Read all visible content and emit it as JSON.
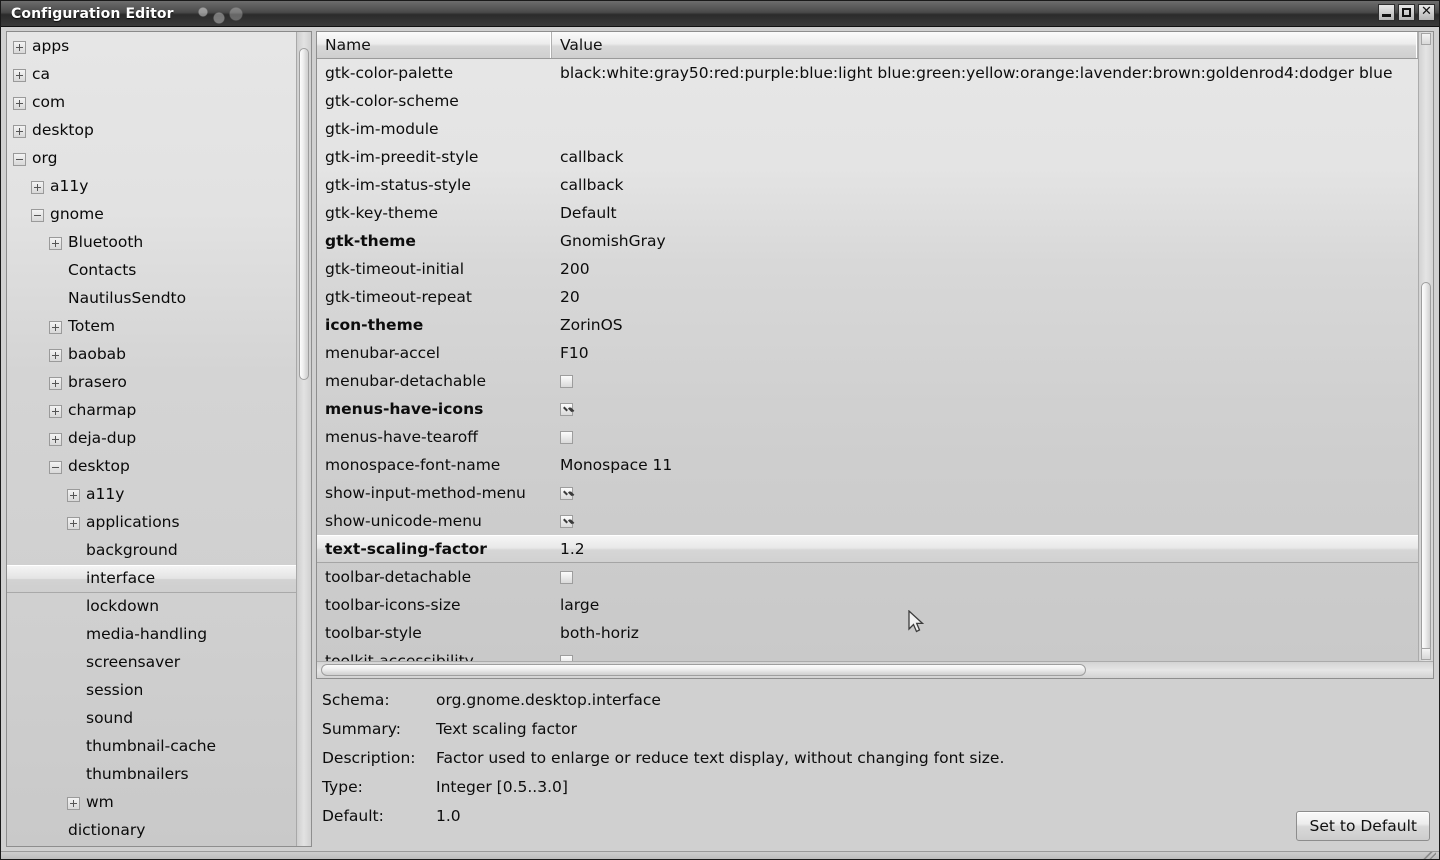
{
  "window": {
    "title": "Configuration Editor",
    "controls": {
      "minimize": "minimize-icon",
      "maximize": "maximize-icon",
      "close": "✕"
    }
  },
  "tree": {
    "items": [
      {
        "label": "apps",
        "depth": 0,
        "expander": "plus"
      },
      {
        "label": "ca",
        "depth": 0,
        "expander": "plus"
      },
      {
        "label": "com",
        "depth": 0,
        "expander": "plus"
      },
      {
        "label": "desktop",
        "depth": 0,
        "expander": "plus"
      },
      {
        "label": "org",
        "depth": 0,
        "expander": "minus"
      },
      {
        "label": "a11y",
        "depth": 1,
        "expander": "plus"
      },
      {
        "label": "gnome",
        "depth": 1,
        "expander": "minus"
      },
      {
        "label": "Bluetooth",
        "depth": 2,
        "expander": "plus"
      },
      {
        "label": "Contacts",
        "depth": 2,
        "expander": "none"
      },
      {
        "label": "NautilusSendto",
        "depth": 2,
        "expander": "none"
      },
      {
        "label": "Totem",
        "depth": 2,
        "expander": "plus"
      },
      {
        "label": "baobab",
        "depth": 2,
        "expander": "plus"
      },
      {
        "label": "brasero",
        "depth": 2,
        "expander": "plus"
      },
      {
        "label": "charmap",
        "depth": 2,
        "expander": "plus"
      },
      {
        "label": "deja-dup",
        "depth": 2,
        "expander": "plus"
      },
      {
        "label": "desktop",
        "depth": 2,
        "expander": "minus"
      },
      {
        "label": "a11y",
        "depth": 3,
        "expander": "plus"
      },
      {
        "label": "applications",
        "depth": 3,
        "expander": "plus"
      },
      {
        "label": "background",
        "depth": 3,
        "expander": "none"
      },
      {
        "label": "interface",
        "depth": 3,
        "expander": "none",
        "selected": true
      },
      {
        "label": "lockdown",
        "depth": 3,
        "expander": "none"
      },
      {
        "label": "media-handling",
        "depth": 3,
        "expander": "none"
      },
      {
        "label": "screensaver",
        "depth": 3,
        "expander": "none"
      },
      {
        "label": "session",
        "depth": 3,
        "expander": "none"
      },
      {
        "label": "sound",
        "depth": 3,
        "expander": "none"
      },
      {
        "label": "thumbnail-cache",
        "depth": 3,
        "expander": "none"
      },
      {
        "label": "thumbnailers",
        "depth": 3,
        "expander": "none"
      },
      {
        "label": "wm",
        "depth": 3,
        "expander": "plus"
      },
      {
        "label": "dictionary",
        "depth": 2,
        "expander": "none"
      }
    ]
  },
  "list": {
    "columns": [
      "Name",
      "Value"
    ],
    "rows": [
      {
        "name": "gtk-color-palette",
        "value": "black:white:gray50:red:purple:blue:light blue:green:yellow:orange:lavender:brown:goldenrod4:dodger blue",
        "type": "text"
      },
      {
        "name": "gtk-color-scheme",
        "value": "",
        "type": "text"
      },
      {
        "name": "gtk-im-module",
        "value": "",
        "type": "text"
      },
      {
        "name": "gtk-im-preedit-style",
        "value": "callback",
        "type": "text"
      },
      {
        "name": "gtk-im-status-style",
        "value": "callback",
        "type": "text"
      },
      {
        "name": "gtk-key-theme",
        "value": "Default",
        "type": "text"
      },
      {
        "name": "gtk-theme",
        "value": "GnomishGray",
        "type": "text",
        "modified": true
      },
      {
        "name": "gtk-timeout-initial",
        "value": "200",
        "type": "text"
      },
      {
        "name": "gtk-timeout-repeat",
        "value": "20",
        "type": "text"
      },
      {
        "name": "icon-theme",
        "value": "ZorinOS",
        "type": "text",
        "modified": true
      },
      {
        "name": "menubar-accel",
        "value": "F10",
        "type": "text"
      },
      {
        "name": "menubar-detachable",
        "value": "false",
        "type": "checkbox"
      },
      {
        "name": "menus-have-icons",
        "value": "true",
        "type": "checkbox",
        "modified": true
      },
      {
        "name": "menus-have-tearoff",
        "value": "false",
        "type": "checkbox"
      },
      {
        "name": "monospace-font-name",
        "value": "Monospace 11",
        "type": "text"
      },
      {
        "name": "show-input-method-menu",
        "value": "true",
        "type": "checkbox"
      },
      {
        "name": "show-unicode-menu",
        "value": "true",
        "type": "checkbox"
      },
      {
        "name": "text-scaling-factor",
        "value": "1.2",
        "type": "text",
        "modified": true,
        "selected": true
      },
      {
        "name": "toolbar-detachable",
        "value": "false",
        "type": "checkbox"
      },
      {
        "name": "toolbar-icons-size",
        "value": "large",
        "type": "text"
      },
      {
        "name": "toolbar-style",
        "value": "both-horiz",
        "type": "text"
      },
      {
        "name": "toolkit-accessibility",
        "value": "false",
        "type": "checkbox"
      }
    ]
  },
  "detail": {
    "fields": [
      {
        "label": "Schema:",
        "value": "org.gnome.desktop.interface"
      },
      {
        "label": "Summary:",
        "value": "Text scaling factor"
      },
      {
        "label": "Description:",
        "value": "Factor used to enlarge or reduce text display, without changing font size."
      },
      {
        "label": "Type:",
        "value": "Integer [0.5..3.0]"
      },
      {
        "label": "Default:",
        "value": "1.0"
      }
    ],
    "set_default_label": "Set to Default"
  }
}
